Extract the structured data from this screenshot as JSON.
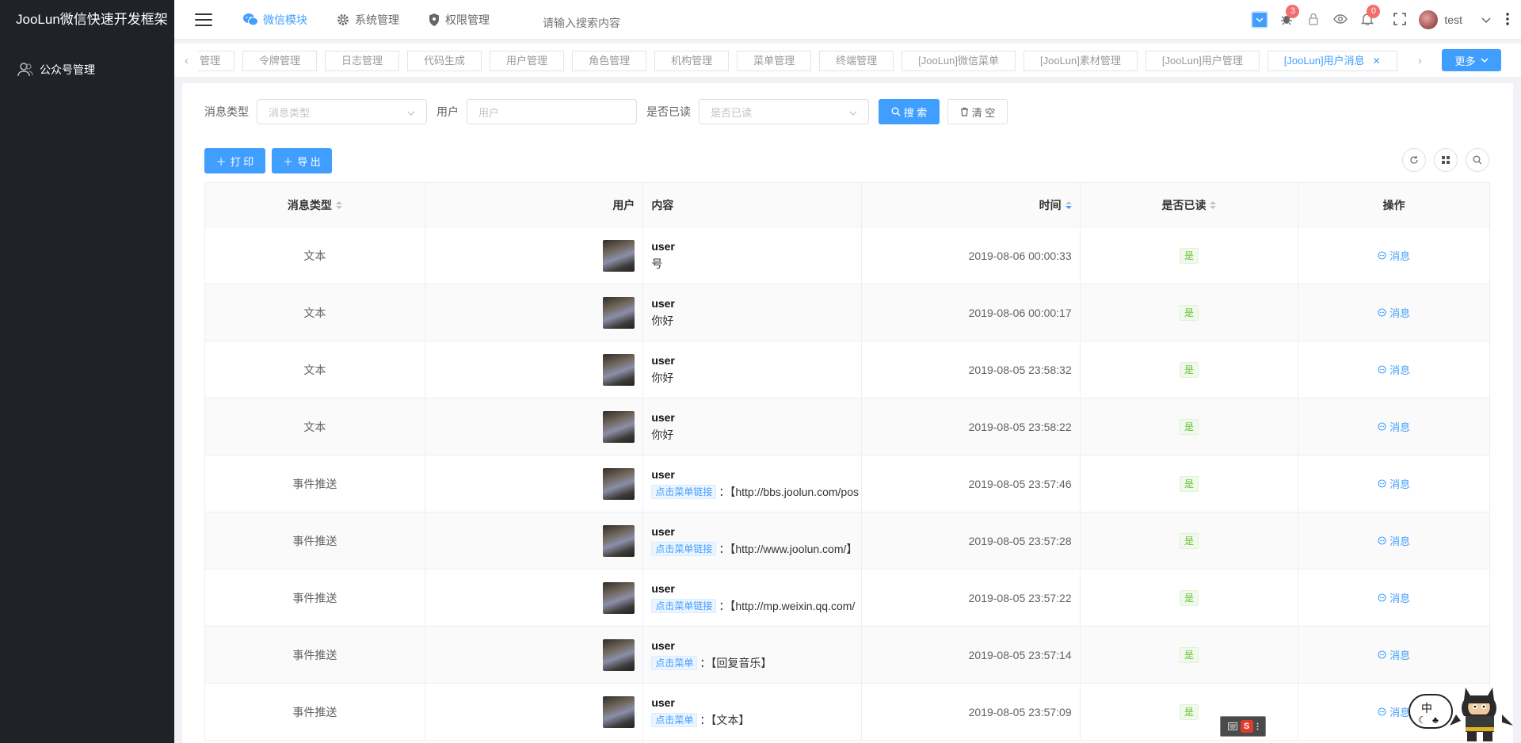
{
  "app": {
    "title": "JooLun微信快速开发框架"
  },
  "sidebar": {
    "items": [
      {
        "label": "公众号管理",
        "icon": "users-icon"
      }
    ]
  },
  "header": {
    "nav": [
      {
        "label": "微信模块",
        "icon": "wechat-icon",
        "active": true
      },
      {
        "label": "系统管理",
        "icon": "gear-icon",
        "active": false
      },
      {
        "label": "权限管理",
        "icon": "shield-icon",
        "active": false
      }
    ],
    "search_placeholder": "请输入搜索内容",
    "bug_badge": "3",
    "notice_badge": "0",
    "username": "test"
  },
  "tabs": {
    "items": [
      {
        "label": "管理",
        "active": false
      },
      {
        "label": "令牌管理",
        "active": false
      },
      {
        "label": "日志管理",
        "active": false
      },
      {
        "label": "代码生成",
        "active": false
      },
      {
        "label": "用户管理",
        "active": false
      },
      {
        "label": "角色管理",
        "active": false
      },
      {
        "label": "机构管理",
        "active": false
      },
      {
        "label": "菜单管理",
        "active": false
      },
      {
        "label": "终端管理",
        "active": false
      },
      {
        "label": "[JooLun]微信菜单",
        "active": false
      },
      {
        "label": "[JooLun]素材管理",
        "active": false
      },
      {
        "label": "[JooLun]用户管理",
        "active": false
      },
      {
        "label": "[JooLun]用户消息",
        "active": true
      }
    ],
    "more_label": "更多"
  },
  "filters": {
    "msg_type_label": "消息类型",
    "msg_type_placeholder": "消息类型",
    "user_label": "用户",
    "user_placeholder": "用户",
    "read_label": "是否已读",
    "read_placeholder": "是否已读",
    "search_label": "搜 索",
    "clear_label": "清 空"
  },
  "actions": {
    "print_label": "打 印",
    "export_label": "导 出"
  },
  "table": {
    "columns": [
      "消息类型",
      "用户",
      "内容",
      "时间",
      "是否已读",
      "操作"
    ],
    "rows": [
      {
        "type": "文本",
        "user": "user",
        "tag": "",
        "text": "号",
        "time": "2019-08-06 00:00:33",
        "read": "是",
        "op": "消息"
      },
      {
        "type": "文本",
        "user": "user",
        "tag": "",
        "text": "你好",
        "time": "2019-08-06 00:00:17",
        "read": "是",
        "op": "消息"
      },
      {
        "type": "文本",
        "user": "user",
        "tag": "",
        "text": "你好",
        "time": "2019-08-05 23:58:32",
        "read": "是",
        "op": "消息"
      },
      {
        "type": "文本",
        "user": "user",
        "tag": "",
        "text": "你好",
        "time": "2019-08-05 23:58:22",
        "read": "是",
        "op": "消息"
      },
      {
        "type": "事件推送",
        "user": "user",
        "tag": "点击菜单链接",
        "text": "：【http://bbs.joolun.com/pos",
        "time": "2019-08-05 23:57:46",
        "read": "是",
        "op": "消息"
      },
      {
        "type": "事件推送",
        "user": "user",
        "tag": "点击菜单链接",
        "text": "：【http://www.joolun.com/】",
        "time": "2019-08-05 23:57:28",
        "read": "是",
        "op": "消息"
      },
      {
        "type": "事件推送",
        "user": "user",
        "tag": "点击菜单链接",
        "text": "：【http://mp.weixin.qq.com/",
        "time": "2019-08-05 23:57:22",
        "read": "是",
        "op": "消息"
      },
      {
        "type": "事件推送",
        "user": "user",
        "tag": "点击菜单",
        "text": "：【回复音乐】",
        "time": "2019-08-05 23:57:14",
        "read": "是",
        "op": "消息"
      },
      {
        "type": "事件推送",
        "user": "user",
        "tag": "点击菜单",
        "text": "：【文本】",
        "time": "2019-08-05 23:57:09",
        "read": "是",
        "op": "消息"
      }
    ]
  },
  "overlay": {
    "ime_label": "中"
  },
  "colors": {
    "primary": "#409eff",
    "sidebar": "#20222a",
    "success": "#67c23a",
    "danger": "#f56c6c"
  }
}
